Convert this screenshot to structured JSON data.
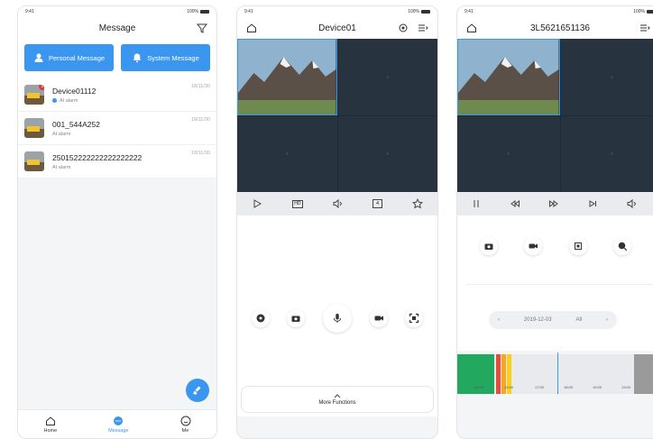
{
  "status": {
    "time": "9:41",
    "battery": "100%"
  },
  "message_screen": {
    "title": "Message",
    "tabs": {
      "personal": "Personal Message",
      "system": "System Message"
    },
    "items": [
      {
        "name": "Device01112",
        "sub": "AI alarm",
        "date": "18/11/30",
        "badge": "5",
        "has_dot": true
      },
      {
        "name": "001_544A252",
        "sub": "AI alarm",
        "date": "18/11/30"
      },
      {
        "name": "250152222222222222222",
        "sub": "AI alarm",
        "date": "18/11/30"
      }
    ],
    "tabbar": {
      "home": "Home",
      "message": "Message",
      "me": "Me"
    }
  },
  "live_screen": {
    "title": "Device01",
    "controls": {
      "hd": "HD",
      "split": "4"
    },
    "more_functions": "More Functions"
  },
  "playback_screen": {
    "title": "3L5621651136",
    "date": "2019-12-03",
    "filter": "All",
    "timeline_labels": [
      "00:00",
      "12:00",
      "17:00",
      "18:00",
      "19:00",
      "13:00"
    ]
  },
  "colors": {
    "accent": "#3a96ee",
    "badge": "#e5383b",
    "grid_bg": "#27333e"
  }
}
